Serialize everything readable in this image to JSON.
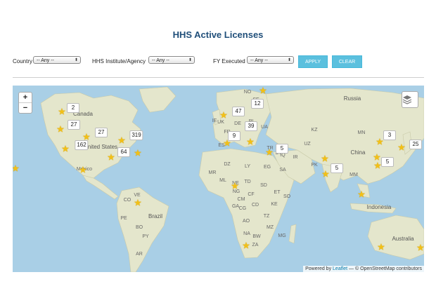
{
  "page": {
    "title": "HHS Active Licenses"
  },
  "filters": {
    "country_label": "Country",
    "country_value": "-- Any --",
    "agency_label": "HHS Institute/Agency",
    "agency_value": "-- Any --",
    "fy_label": "FY Executed",
    "fy_value": "-- Any --",
    "apply_label": "APPLY",
    "clear_label": "CLEAR"
  },
  "map": {
    "zoom_in": "+",
    "zoom_out": "−",
    "layers_icon": "layers-icon",
    "attribution_prefix": "Powered by",
    "attribution_link": "Leaflet",
    "attribution_suffix": "— © OpenStreetMap contributors",
    "colors": {
      "water": "#a9cfe6",
      "land": "#e4e6cc",
      "marker": "#f2c017",
      "button": "#5bc0de"
    },
    "countries": [
      "Canada",
      "United States",
      "Mexico",
      "Russia",
      "Brazil",
      "Indonesia",
      "Australia",
      "China",
      "KZ",
      "MN",
      "IR",
      "PK",
      "SA",
      "DZ",
      "LY",
      "EG",
      "SD",
      "ML",
      "TD",
      "NE",
      "ET",
      "KE",
      "TZ",
      "CD",
      "AO",
      "NA",
      "ZA",
      "VE",
      "CO",
      "PE",
      "BO",
      "PY",
      "AR",
      "UK",
      "FR",
      "ES",
      "DE",
      "UA",
      "TR",
      "IQ",
      "NG",
      "CF",
      "MM",
      "CG",
      "MZ",
      "BW",
      "MG",
      "SO",
      "MR",
      "CM",
      "GA",
      "IE",
      "PL",
      "NO",
      "SE",
      "SY",
      "UZ"
    ],
    "clusters": [
      "2",
      "27",
      "27",
      "162",
      "319",
      "64",
      "47",
      "12",
      "39",
      "9",
      "5",
      "3",
      "25",
      "5",
      "5"
    ]
  }
}
